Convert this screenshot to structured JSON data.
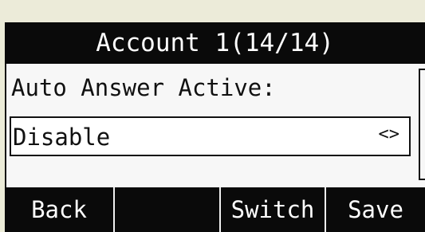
{
  "title": "Account 1(14/14)",
  "setting": {
    "label": "Auto Answer Active:",
    "value": "Disable",
    "arrows": "<>"
  },
  "softkeys": {
    "back": "Back",
    "empty": "",
    "switch": "Switch",
    "save": "Save"
  }
}
